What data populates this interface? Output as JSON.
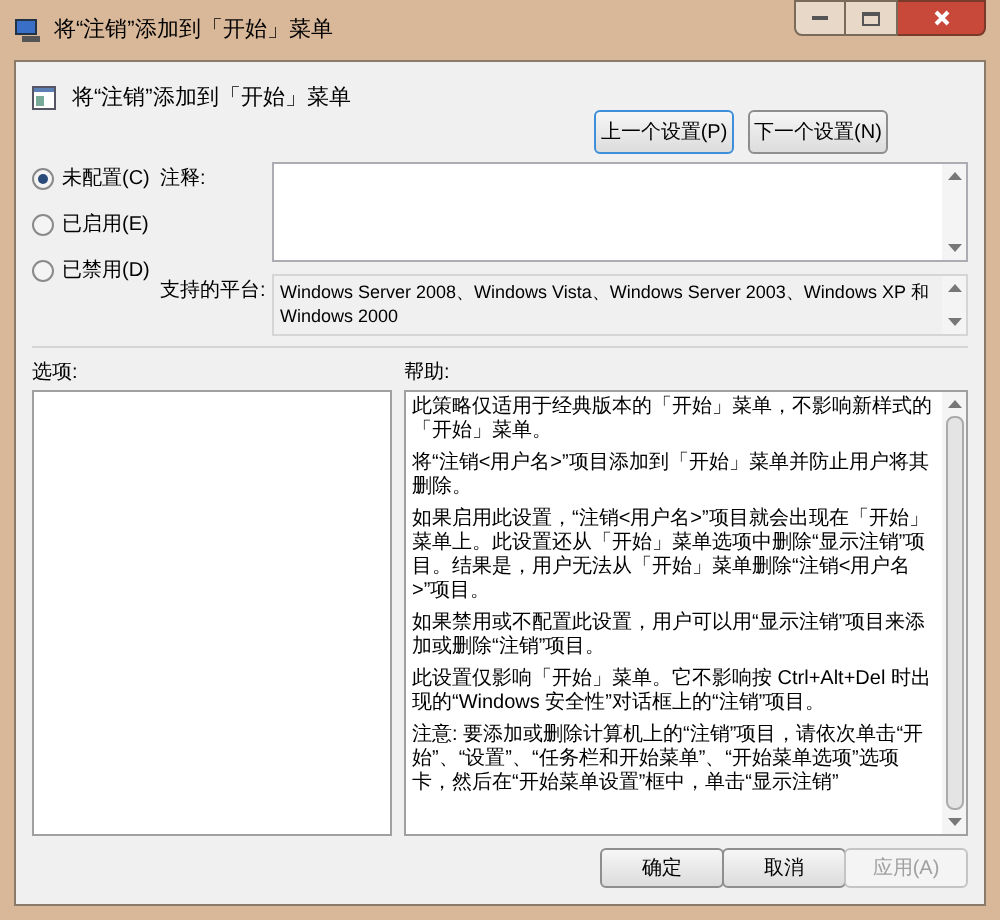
{
  "window": {
    "title": "将“注销”添加到「开始」菜单"
  },
  "header": {
    "title": "将“注销”添加到「开始」菜单"
  },
  "nav_buttons": [
    {
      "label": "上一个设置(P)",
      "focused": true
    },
    {
      "label": "下一个设置(N)",
      "focused": false
    }
  ],
  "options": [
    {
      "label": "未配置(C)",
      "selected": true
    },
    {
      "label": "已启用(E)",
      "selected": false
    },
    {
      "label": "已禁用(D)",
      "selected": false
    }
  ],
  "comment": {
    "label": "注释:"
  },
  "platform": {
    "label": "支持的平台:",
    "value": "Windows Server 2008、Windows Vista、Windows Server 2003、Windows XP 和 Windows 2000"
  },
  "options_panel": {
    "label": "选项:"
  },
  "help": {
    "label": "帮助:",
    "paragraphs": [
      "此策略仅适用于经典版本的「开始」菜单，不影响新样式的「开始」菜单。",
      "将“注销<用户名>”项目添加到「开始」菜单并防止用户将其删除。",
      "如果启用此设置，“注销<用户名>”项目就会出现在「开始」菜单上。此设置还从「开始」菜单选项中删除“显示注销”项目。结果是，用户无法从「开始」菜单删除“注销<用户名>”项目。",
      "如果禁用或不配置此设置，用户可以用“显示注销”项目来添加或删除“注销”项目。",
      "此设置仅影响「开始」菜单。它不影响按 Ctrl+Alt+Del 时出现的“Windows 安全性”对话框上的“注销”项目。",
      "注意: 要添加或删除计算机上的“注销”项目，请依次单击“开始”、“设置”、“任务栏和开始菜单”、“开始菜单选项”选项卡，然后在“开始菜单设置”框中，单击“显示注销”"
    ]
  },
  "buttons": [
    {
      "label": "确定",
      "disabled": false
    },
    {
      "label": "取消",
      "disabled": false
    },
    {
      "label": "应用(A)",
      "disabled": true
    }
  ]
}
